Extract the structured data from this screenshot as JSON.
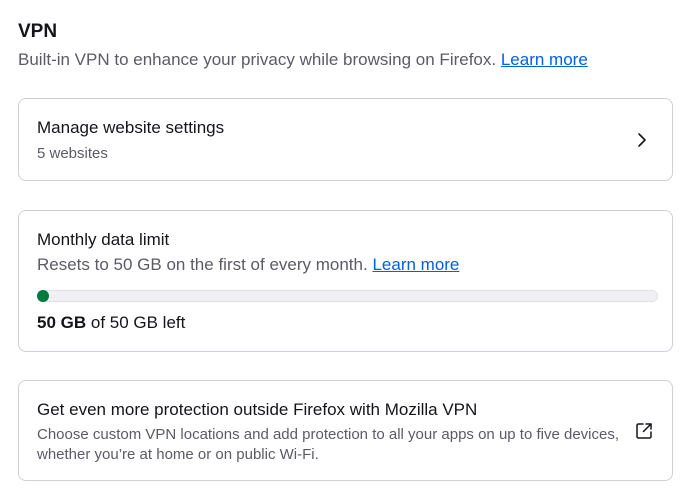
{
  "vpn": {
    "title": "VPN",
    "description": "Built-in VPN to enhance your privacy while browsing on Firefox.",
    "learn_more": "Learn more"
  },
  "website_settings": {
    "title": "Manage website settings",
    "subtitle": "5 websites",
    "icon": "chevron-right-icon"
  },
  "data_limit": {
    "title": "Monthly data limit",
    "reset_text": "Resets to 50 GB on the first of every month.",
    "learn_more": "Learn more",
    "remaining": "50 GB",
    "remaining_suffix": " of 50 GB left",
    "used_fraction": 0.0,
    "bar_color": "#017a40"
  },
  "promo": {
    "title": "Get even more protection outside Firefox with Mozilla VPN",
    "description": "Choose custom VPN locations and add protection to all your apps on up to five devices, whether you’re at home or on public Wi-Fi.",
    "icon": "external-link-icon"
  },
  "colors": {
    "link": "#0061e0",
    "text": "#15141a",
    "secondary_text": "#5b5b66",
    "border": "#cfcfd8"
  }
}
